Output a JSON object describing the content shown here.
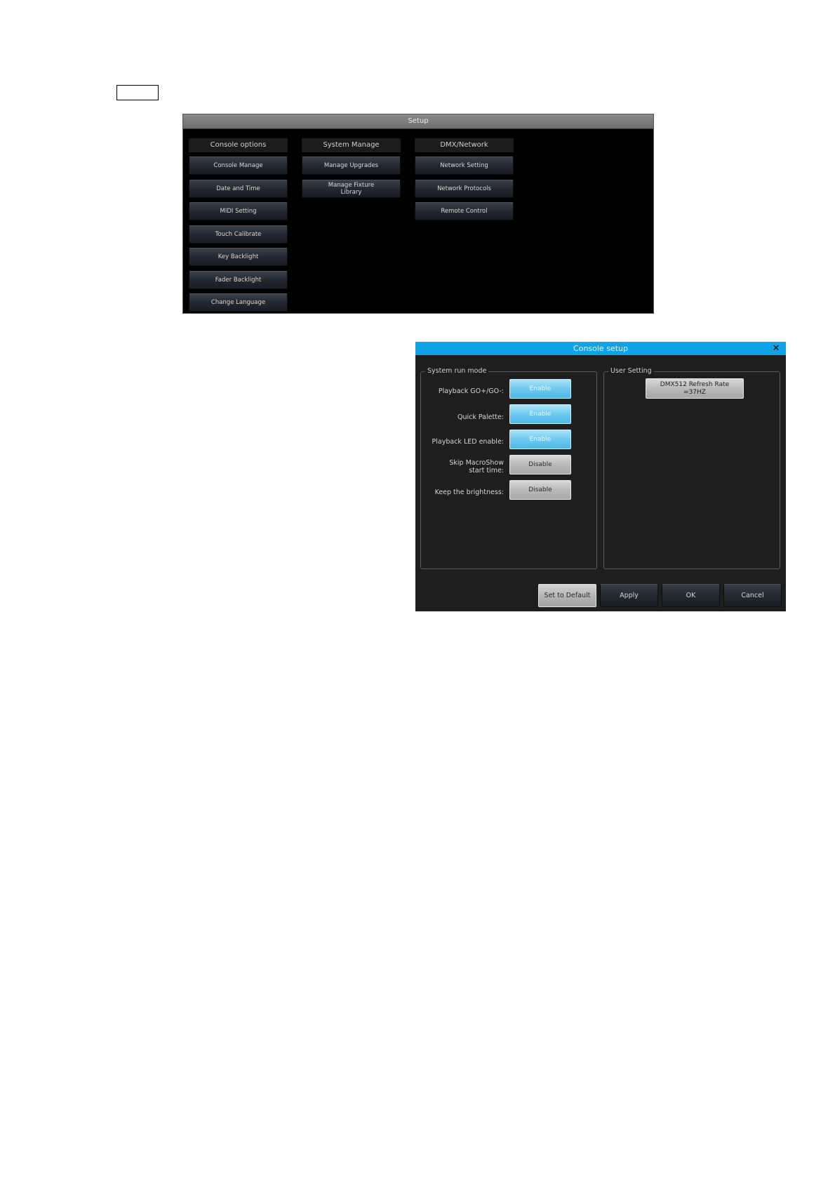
{
  "setup": {
    "title": "Setup",
    "columns": [
      {
        "header": "Console options",
        "items": [
          "Console Manage",
          "Date and Time",
          "MIDI Setting",
          "Touch Calibrate",
          "Key Backlight",
          "Fader Backlight",
          "Change Language"
        ]
      },
      {
        "header": "System Manage",
        "items": [
          "Manage Upgrades",
          "Manage Fixture\nLibrary"
        ]
      },
      {
        "header": "DMX/Network",
        "items": [
          "Network Setting",
          "Network Protocols",
          "Remote Control"
        ]
      }
    ]
  },
  "console_setup": {
    "title": "Console setup",
    "close_glyph": "✕",
    "system_run_mode": {
      "label": "System run mode",
      "rows": [
        {
          "label": "Playback GO+/GO-:",
          "value": "Enable"
        },
        {
          "label": "Quick Palette:",
          "value": "Enable"
        },
        {
          "label": "Playback LED enable:",
          "value": "Enable"
        },
        {
          "label": "Skip MacroShow\nstart time:",
          "value": "Disable"
        },
        {
          "label": "Keep the brightness:",
          "value": "Disable"
        }
      ]
    },
    "user_setting": {
      "label": "User Setting",
      "refresh_line1": "DMX512 Refresh Rate",
      "refresh_line2": "=37HZ"
    },
    "buttons": {
      "set_default": "Set to Default",
      "apply": "Apply",
      "ok": "OK",
      "cancel": "Cancel"
    }
  },
  "colors": {
    "dialog_title_bar": "#0da3e6",
    "enable_toggle": "#6fc9ef",
    "disable_toggle": "#b9b9b9"
  }
}
